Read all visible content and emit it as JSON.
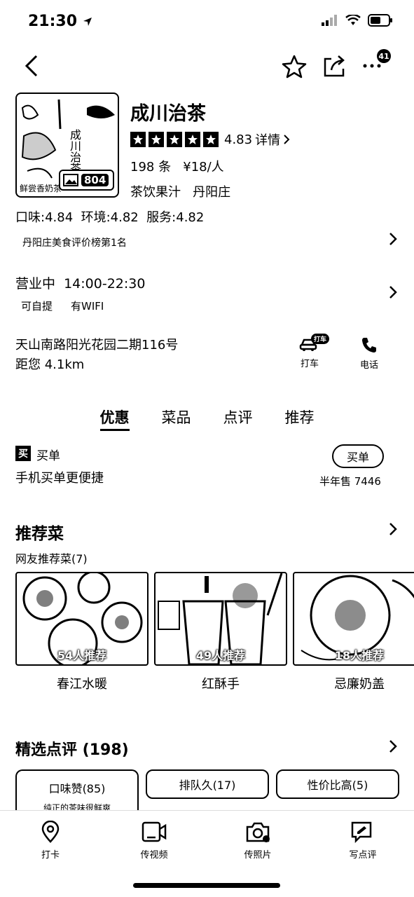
{
  "status_bar": {
    "time": "21:30"
  },
  "nav": {
    "more_badge": "41"
  },
  "shop": {
    "name": "成川治茶",
    "photo_count": "804",
    "cover_text": "成川治茶",
    "cover_bottom_text": "鲜尝香奶茶",
    "rating": "4.83",
    "rating_detail_label": "详情",
    "stars": 5,
    "reviews_price": "198 条   ¥18/人",
    "category_area": "茶饮果汁   丹阳庄",
    "sub_scores": "口味:4.84  环境:4.82  服务:4.82",
    "ranking": "丹阳庄美食评价榜第1名",
    "open_status": "营业中  14:00-22:30",
    "features": [
      "可自提",
      "有WIFI"
    ],
    "address": "天山南路阳光花园二期116号",
    "distance": "距您 4.1km",
    "taxi_label": "打车",
    "taxi_badge": "打车",
    "call_label": "电话"
  },
  "tabs": [
    "优惠",
    "菜品",
    "点评",
    "推荐"
  ],
  "buy": {
    "icon_char": "买",
    "title": "买单",
    "subtitle": "手机买单更便捷",
    "button": "买单",
    "sales": "半年售 7446"
  },
  "recommended": {
    "title": "推荐菜",
    "subtitle": "网友推荐菜(7)",
    "dishes": [
      {
        "name": "春江水暖",
        "count": "54人推荐"
      },
      {
        "name": "红酥手",
        "count": "49人推荐"
      },
      {
        "name": "忌廉奶盖",
        "count": "18人推荐"
      }
    ]
  },
  "featured_reviews": {
    "title": "精选点评 (198)",
    "tags": [
      {
        "label": "口味赞(85)",
        "snippet": "纯正的茶味很鲜爽"
      },
      {
        "label": "排队久(17)"
      },
      {
        "label": "性价比高(5)"
      }
    ]
  },
  "bottom_bar": [
    {
      "label": "打卡",
      "icon": "location-pin-icon"
    },
    {
      "label": "传视频",
      "icon": "video-icon"
    },
    {
      "label": "传照片",
      "icon": "camera-icon"
    },
    {
      "label": "写点评",
      "icon": "write-review-icon"
    }
  ]
}
